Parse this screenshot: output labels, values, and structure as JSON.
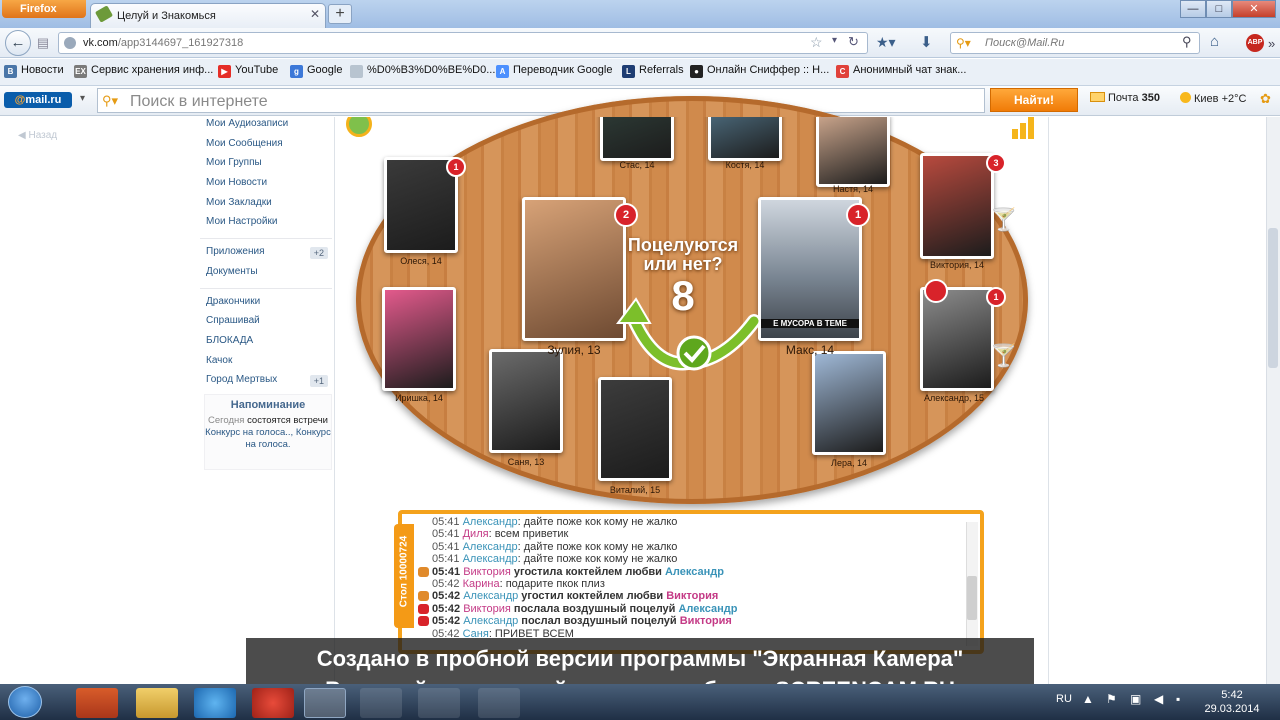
{
  "browser": {
    "menu_button": "Firefox",
    "tab_title": "Целуй и Знакомься",
    "url_domain": "vk.com",
    "url_path": "/app3144697_161927318",
    "search_placeholder": "Поиск@Mail.Ru",
    "window_buttons": [
      "—",
      "□",
      "✕"
    ]
  },
  "bookmarks": [
    {
      "label": "Новости",
      "icon": "vk-icon",
      "color": "#4a76a8",
      "glyph": "B"
    },
    {
      "label": "Сервис хранения инф...",
      "icon": "ex-icon",
      "color": "#7a7a7a",
      "glyph": "EX"
    },
    {
      "label": "YouTube",
      "icon": "youtube-icon",
      "color": "#e52d27",
      "glyph": "▶"
    },
    {
      "label": "Google",
      "icon": "google-icon",
      "color": "#3c78d8",
      "glyph": "g"
    },
    {
      "label": "%D0%B3%D0%BE%D0...",
      "icon": "page-icon",
      "color": "#b8c4d0",
      "glyph": ""
    },
    {
      "label": "Переводчик Google",
      "icon": "translate-icon",
      "color": "#4d90fe",
      "glyph": "A"
    },
    {
      "label": "Referrals",
      "icon": "referrals-icon",
      "color": "#1e3d73",
      "glyph": "L"
    },
    {
      "label": "Онлайн Сниффер :: Н...",
      "icon": "sniffer-icon",
      "color": "#222222",
      "glyph": "●"
    },
    {
      "label": "Анонимный чат знак...",
      "icon": "chat-icon",
      "color": "#e0413a",
      "glyph": "C"
    }
  ],
  "mailru": {
    "logo_at": "@",
    "logo_text": "mail.ru",
    "search_placeholder": "Поиск в интернете",
    "find_button": "Найти!",
    "mail_label": "Почта",
    "mail_count": "350",
    "weather": "Киев +2°C"
  },
  "sidebar": {
    "back_link": "Назад",
    "items": [
      {
        "label": "Мои Аудиозаписи"
      },
      {
        "label": "Мои Сообщения"
      },
      {
        "label": "Мои Группы"
      },
      {
        "label": "Мои Новости"
      },
      {
        "label": "Мои Закладки"
      },
      {
        "label": "Мои Настройки"
      }
    ],
    "items2": [
      {
        "label": "Приложения",
        "count": "+2"
      },
      {
        "label": "Документы",
        "count": ""
      }
    ],
    "items3": [
      {
        "label": "Дракончики",
        "count": ""
      },
      {
        "label": "Спрашивай",
        "count": ""
      },
      {
        "label": "БЛОКАДА",
        "count": ""
      },
      {
        "label": "Качок",
        "count": ""
      },
      {
        "label": "Город Мертвых",
        "count": "+1"
      }
    ],
    "reminder": {
      "title": "Напоминание",
      "t1": "Сегодня",
      "t2": "состоятся встречи",
      "t3": "Конкурс на голоса..",
      "t4": ", Конкурс на голоса."
    }
  },
  "game": {
    "question": "Поцелуются или нет?",
    "countdown": "8",
    "players": [
      {
        "name": "Стас, 14",
        "kisses": "",
        "bg": "#2d3b36"
      },
      {
        "name": "Костя, 14",
        "kisses": "",
        "bg": "#4d6c7e"
      },
      {
        "name": "Настя, 14",
        "kisses": "",
        "bg": "#c9a48b"
      },
      {
        "name": "Олеся, 14",
        "kisses": "1",
        "bg": "#3a3a3a"
      },
      {
        "name": "Виктория, 14",
        "kisses": "3",
        "bg": "#b84a3e"
      },
      {
        "name": "Иришка, 14",
        "kisses": "",
        "bg": "#e35a8c"
      },
      {
        "name": "Александр, 15",
        "kisses": "1",
        "bg": "#8c8c8c"
      },
      {
        "name": "Саня, 13",
        "kisses": "",
        "bg": "#6b6b6b"
      },
      {
        "name": "Виталий, 15",
        "kisses": "",
        "bg": "#3c3c3c"
      },
      {
        "name": "Лера, 14",
        "kisses": "",
        "bg": "#9fb8d6"
      }
    ],
    "center_left": {
      "name": "Зулия, 13",
      "kisses": "2",
      "bg": "#d7a277"
    },
    "center_right": {
      "name": "Макс, 14",
      "kisses": "1",
      "bg": "#7b8794",
      "caption": "Е МУСОРА В ТЕМЕ"
    }
  },
  "chat": {
    "table_label": "Стол 10000724",
    "lines": [
      {
        "time": "05:41",
        "bold": false,
        "who": "Александр",
        "wcls": "bl",
        "sep": ":",
        "text": " дайте поже кок кому не жалко",
        "icon": ""
      },
      {
        "time": "05:41",
        "bold": false,
        "who": "Диля",
        "wcls": "pk",
        "sep": ":",
        "text": " всем приветик",
        "icon": ""
      },
      {
        "time": "05:41",
        "bold": false,
        "who": "Александр",
        "wcls": "bl",
        "sep": ":",
        "text": " дайте поже кок кому не жалко",
        "icon": ""
      },
      {
        "time": "05:41",
        "bold": false,
        "who": "Александр",
        "wcls": "bl",
        "sep": ":",
        "text": " дайте поже кок кому не жалко",
        "icon": ""
      },
      {
        "time": "05:41",
        "bold": true,
        "who": "Виктория",
        "wcls": "pk",
        "sep": "",
        "text": " угостила коктейлем любви ",
        "to": "Александр",
        "tcls": "bl",
        "icon": "gift"
      },
      {
        "time": "05:42",
        "bold": false,
        "who": "Карина",
        "wcls": "pk",
        "sep": ":",
        "text": " подарите пкок плиз",
        "icon": ""
      },
      {
        "time": "05:42",
        "bold": true,
        "who": "Александр",
        "wcls": "bl",
        "sep": "",
        "text": " угостил коктейлем любви ",
        "to": "Виктория",
        "tcls": "pk",
        "icon": "gift"
      },
      {
        "time": "05:42",
        "bold": true,
        "who": "Виктория",
        "wcls": "pk",
        "sep": "",
        "text": " послала воздушный поцелуй ",
        "to": "Александр",
        "tcls": "bl",
        "icon": "kiss"
      },
      {
        "time": "05:42",
        "bold": true,
        "who": "Александр",
        "wcls": "bl",
        "sep": "",
        "text": " послал воздушный поцелуй ",
        "to": "Виктория",
        "tcls": "pk",
        "icon": "kiss"
      },
      {
        "time": "05:42",
        "bold": false,
        "who": "Саня",
        "wcls": "bl",
        "sep": ":",
        "text": " ПРИВЕТ ВСЕМ",
        "icon": ""
      }
    ]
  },
  "watermark": {
    "line1": "Создано в пробной версии программы \"Экранная Камера\"",
    "line2": "В полной версии этой надписи не будет. SCREENCAM.RU"
  },
  "taskbar": {
    "lang": "RU",
    "time": "5:42",
    "date": "29.03.2014"
  }
}
